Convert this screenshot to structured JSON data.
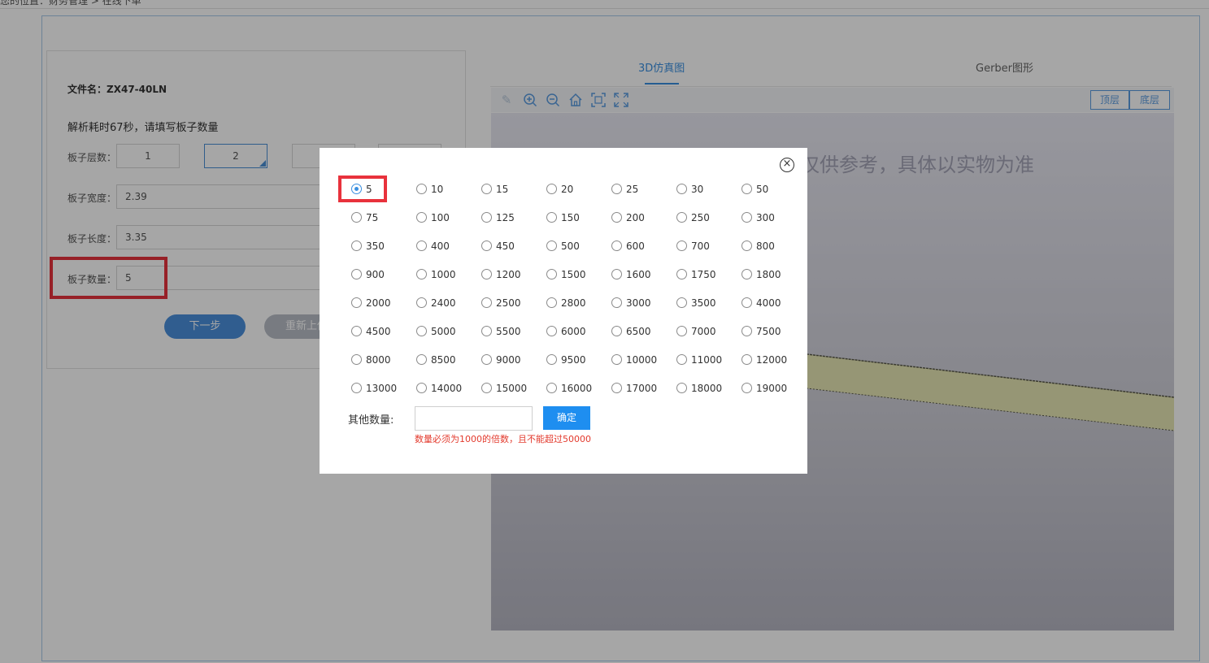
{
  "breadcrumb": "您的位置：财务管理 > 在线下单",
  "left_panel": {
    "file_name_label": "文件名：",
    "file_name": "ZX47-40LN",
    "parse_message": "解析耗时67秒，请填写板子数量",
    "layers_label": "板子层数：",
    "layer_options": [
      "1",
      "2",
      "",
      ""
    ],
    "width_label": "板子宽度：",
    "width_value": "2.39",
    "length_label": "板子长度：",
    "length_value": "3.35",
    "quantity_label": "板子数量：",
    "quantity_value": "5",
    "next_button": "下一步",
    "reupload_button": "重新上传"
  },
  "right_panel": {
    "tabs": [
      {
        "label": "3D仿真图",
        "active": true
      },
      {
        "label": "Gerber图形",
        "active": false
      }
    ],
    "toolbar_icons": [
      "pencil-icon",
      "zoom-in-icon",
      "zoom-out-icon",
      "home-icon",
      "fit-icon",
      "fullscreen-icon"
    ],
    "layer_buttons": [
      "顶层",
      "底层"
    ],
    "viewer_notice": "仅供参考，具体以实物为准"
  },
  "modal": {
    "close_icon": "close-circle-icon",
    "selected": "5",
    "options": [
      "5",
      "10",
      "15",
      "20",
      "25",
      "30",
      "50",
      "75",
      "100",
      "125",
      "150",
      "200",
      "250",
      "300",
      "350",
      "400",
      "450",
      "500",
      "600",
      "700",
      "800",
      "900",
      "1000",
      "1200",
      "1500",
      "1600",
      "1750",
      "1800",
      "2000",
      "2400",
      "2500",
      "2800",
      "3000",
      "3500",
      "4000",
      "4500",
      "5000",
      "5500",
      "6000",
      "6500",
      "7000",
      "7500",
      "8000",
      "8500",
      "9000",
      "9500",
      "10000",
      "11000",
      "12000",
      "13000",
      "14000",
      "15000",
      "16000",
      "17000",
      "18000",
      "19000"
    ],
    "other_label": "其他数量:",
    "other_placeholder": "",
    "confirm_button": "确定",
    "hint": "数量必须为1000的倍数，且不能超过50000"
  },
  "colors": {
    "accent": "#3a8fe0",
    "highlight": "#e8323c",
    "error": "#e33a2d",
    "confirm": "#1e8ef0"
  }
}
